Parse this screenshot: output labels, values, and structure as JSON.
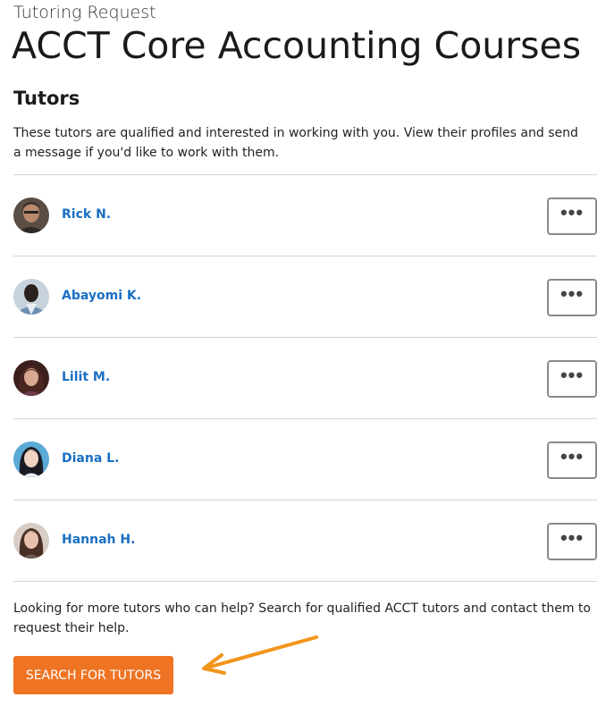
{
  "header": {
    "kicker": "Tutoring Request",
    "title": "ACCT Core Accounting Courses"
  },
  "tutors_section": {
    "heading": "Tutors",
    "intro": "These tutors are qualified and interested in working with you. View their profiles and send a message if you'd like to work with them.",
    "tutors": [
      {
        "name": "Rick N.",
        "more_label": "•••"
      },
      {
        "name": "Abayomi K.",
        "more_label": "•••"
      },
      {
        "name": "Lilit M.",
        "more_label": "•••"
      },
      {
        "name": "Diana L.",
        "more_label": "•••"
      },
      {
        "name": "Hannah H.",
        "more_label": "•••"
      }
    ]
  },
  "footer": {
    "more_text": "Looking for more tutors who can help? Search for qualified ACCT tutors and contact them to request their help.",
    "search_button": "SEARCH FOR TUTORS"
  },
  "colors": {
    "link": "#1a6fc2",
    "button": "#ee7424",
    "arrow": "#f2951c"
  }
}
